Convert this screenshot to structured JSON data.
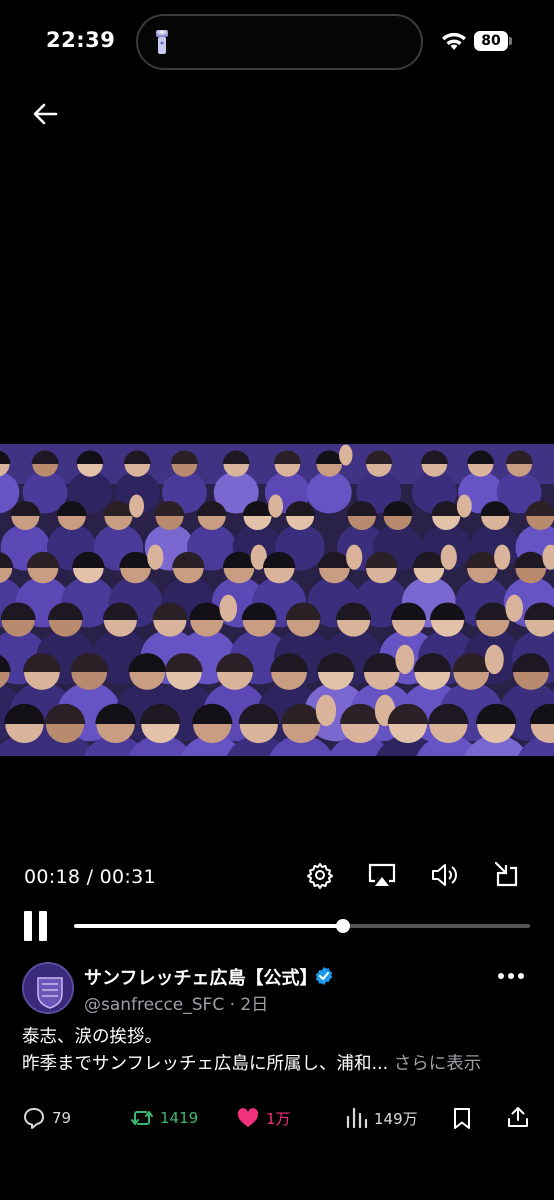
{
  "status_bar": {
    "time": "22:39",
    "battery": "80"
  },
  "player": {
    "current_time": "00:18",
    "duration": "00:31",
    "timecode": "00:18 / 00:31",
    "progress": 0.59
  },
  "author": {
    "display_name": "サンフレッチェ広島【公式】",
    "handle": "@sanfrecce_SFC",
    "age": "2日",
    "handle_line": "@sanfrecce_SFC · 2日"
  },
  "tweet": {
    "line1": "泰志、涙の挨拶。",
    "line2": "昨季までサンフレッチェ広島に所属し、浦和...",
    "show_more": "さらに表示"
  },
  "actions": {
    "replies": "79",
    "retweets": "1419",
    "likes": "1万",
    "views": "149万"
  },
  "colors": {
    "background": "#000000",
    "retweet": "#3bb870",
    "like": "#f0317c",
    "verified": "#1d9bf0",
    "muted": "#9aa0a6"
  },
  "icons": [
    "flashlight-icon",
    "wifi-icon",
    "back-arrow-icon",
    "settings-icon",
    "airplay-icon",
    "volume-icon",
    "exit-fullscreen-icon",
    "pause-icon",
    "verified-badge-icon",
    "more-icon",
    "reply-icon",
    "retweet-icon",
    "like-icon",
    "views-icon",
    "bookmark-icon",
    "share-icon"
  ]
}
